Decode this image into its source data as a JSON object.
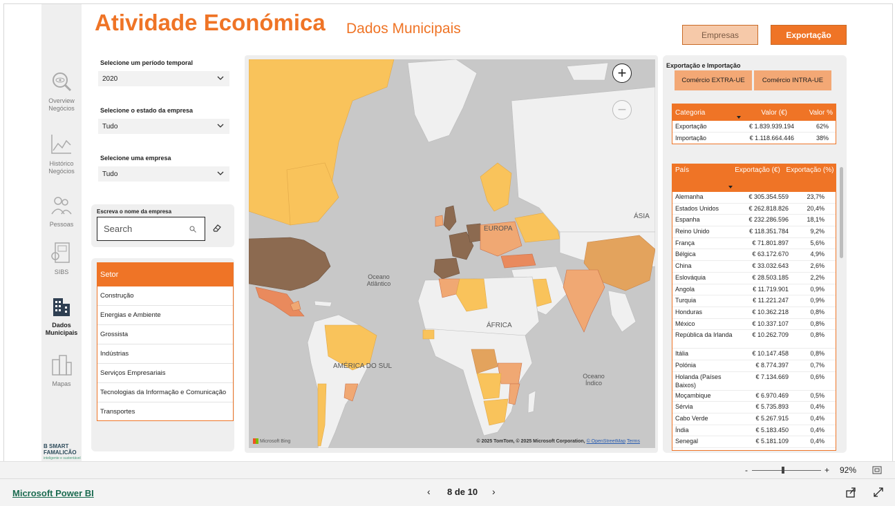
{
  "header": {
    "title": "Atividade Económica",
    "subtitle": "Dados Municipais"
  },
  "toggle": {
    "empresas": "Empresas",
    "exportacao": "Exportação"
  },
  "sidebar": {
    "items": [
      {
        "label": "Overview Negócios"
      },
      {
        "label": "Histórico Negócios"
      },
      {
        "label": "Pessoas"
      },
      {
        "label": "SIBS"
      },
      {
        "label": "Dados Municipais"
      },
      {
        "label": "Mapas"
      }
    ],
    "brand": "B SMART FAMALICÃO",
    "brand_tagline": "inteligente e sustentável"
  },
  "filters": {
    "period_label": "Selecione um período temporal",
    "period_value": "2020",
    "state_label": "Selecione o estado da empresa",
    "state_value": "Tudo",
    "company_label": "Selecione uma empresa",
    "company_value": "Tudo"
  },
  "search": {
    "label": "Escreva o nome da empresa",
    "placeholder": "Search"
  },
  "setor": {
    "header": "Setor",
    "items": [
      "Construção",
      "Energias e Ambiente",
      "Grossista",
      "Indústrias",
      "Serviços Empresariais",
      "Tecnologias da Informação e Comunicação",
      "Transportes"
    ]
  },
  "map": {
    "labels": {
      "europe": "EUROPA",
      "asia": "ÁSIA",
      "atlantic": "Oceano Atlântico",
      "africa": "ÁFRICA",
      "south_america": "AMÉRICA DO SUL",
      "indian": "Oceano Índico"
    },
    "attribution": "© 2025 TomTom, © 2025 Microsoft Corporation,",
    "osm": "© OpenStreetMap",
    "terms": "Terms",
    "bing": "Microsoft Bing",
    "colors": {
      "ocean": "#c8c8c8",
      "land": "#f0f0f0",
      "tier_low": "#f9c35b",
      "tier_mid": "#f0a873",
      "tier_high": "#e98a5d",
      "tier_top": "#8c6a50"
    }
  },
  "trade": {
    "title": "Exportação e Importação",
    "btn_extra": "Comércio EXTRA-UE",
    "btn_intra": "Comércio INTRA-UE",
    "headers": [
      "Categoria",
      "Valor (€)",
      "Valor %"
    ],
    "rows": [
      [
        "Exportação",
        "€ 1.839.939.194",
        "62%"
      ],
      [
        "Importação",
        "€ 1.118.664.446",
        "38%"
      ]
    ]
  },
  "countries": {
    "headers": [
      "País",
      "Exportação (€)",
      "Exportação (%)"
    ],
    "rows": [
      [
        "Alemanha",
        "€ 305.354.559",
        "23,7%"
      ],
      [
        "Estados Unidos",
        "€ 262.818.826",
        "20,4%"
      ],
      [
        "Espanha",
        "€ 232.286.596",
        "18,1%"
      ],
      [
        "Reino Unido",
        "€ 118.351.784",
        "9,2%"
      ],
      [
        "França",
        "€ 71.801.897",
        "5,6%"
      ],
      [
        "Bélgica",
        "€ 63.172.670",
        "4,9%"
      ],
      [
        "China",
        "€ 33.032.643",
        "2,6%"
      ],
      [
        "Eslováquia",
        "€ 28.503.185",
        "2,2%"
      ],
      [
        "Angola",
        "€ 11.719.901",
        "0,9%"
      ],
      [
        "Turquia",
        "€ 11.221.247",
        "0,9%"
      ],
      [
        "Honduras",
        "€ 10.362.218",
        "0,8%"
      ],
      [
        "México",
        "€ 10.337.107",
        "0,8%"
      ],
      [
        "República da Irlanda",
        "€ 10.262.709",
        "0,8%"
      ],
      [
        "Itália",
        "€ 10.147.458",
        "0,8%"
      ],
      [
        "Polónia",
        "€ 8.774.397",
        "0,7%"
      ],
      [
        "Holanda (Países Baixos)",
        "€ 7.134.669",
        "0,6%"
      ],
      [
        "Moçambique",
        "€ 6.970.469",
        "0,5%"
      ],
      [
        "Sérvia",
        "€ 5.735.893",
        "0,4%"
      ],
      [
        "Cabo Verde",
        "€ 5.267.915",
        "0,4%"
      ],
      [
        "Índia",
        "€ 5.183.450",
        "0,4%"
      ],
      [
        "Senegal",
        "€ 5.181.109",
        "0,4%"
      ]
    ]
  },
  "zoom": {
    "minus": "-",
    "plus": "+",
    "percent": "92%"
  },
  "footer": {
    "brand": "Microsoft Power BI",
    "page": "8 de 10"
  }
}
